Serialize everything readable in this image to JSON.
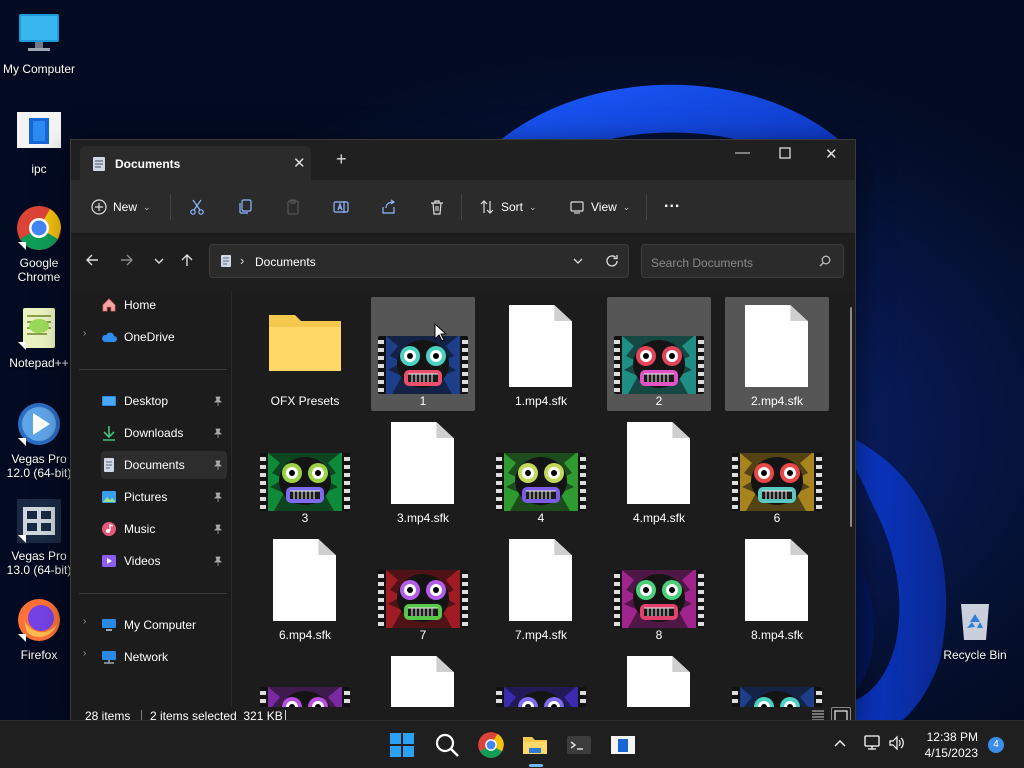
{
  "desktop": {
    "icons": [
      {
        "label": "My Computer"
      },
      {
        "label": "ipc"
      },
      {
        "label": "Google Chrome"
      },
      {
        "label": "Notepad++"
      },
      {
        "label": "Vegas Pro 12.0 (64-bit)"
      },
      {
        "label": "Vegas Pro 13.0 (64-bit)"
      },
      {
        "label": "Firefox"
      },
      {
        "label": "Recycle Bin"
      }
    ]
  },
  "explorer": {
    "tab_title": "Documents",
    "toolbar": {
      "new_label": "New",
      "sort_label": "Sort",
      "view_label": "View",
      "more_label": "..."
    },
    "address": {
      "path": "Documents"
    },
    "search": {
      "placeholder": "Search Documents"
    },
    "nav": {
      "home": "Home",
      "onedrive": "OneDrive",
      "quick": [
        "Desktop",
        "Downloads",
        "Documents",
        "Pictures",
        "Music",
        "Videos"
      ],
      "my_computer": "My Computer",
      "network": "Network"
    },
    "files": [
      {
        "name": "OFX Presets",
        "type": "folder",
        "selected": false
      },
      {
        "name": "1",
        "type": "video",
        "selected": true,
        "bg": "#1d3f8a",
        "eyes": "#4bd1c4",
        "mouth": "#e9506b"
      },
      {
        "name": "1.mp4.sfk",
        "type": "file",
        "selected": false
      },
      {
        "name": "2",
        "type": "video",
        "selected": true,
        "bg": "#1f8f86",
        "eyes": "#e2455a",
        "mouth": "#e254c6"
      },
      {
        "name": "2.mp4.sfk",
        "type": "file",
        "selected": true
      },
      {
        "name": "3",
        "type": "video",
        "selected": false,
        "bg": "#0f8a3a",
        "eyes": "#9bd245",
        "mouth": "#7d6cf2"
      },
      {
        "name": "3.mp4.sfk",
        "type": "file",
        "selected": false
      },
      {
        "name": "4",
        "type": "video",
        "selected": false,
        "bg": "#2f9a2f",
        "eyes": "#c4d85a",
        "mouth": "#7a5ce8"
      },
      {
        "name": "4.mp4.sfk",
        "type": "file",
        "selected": false
      },
      {
        "name": "6",
        "type": "video",
        "selected": false,
        "bg": "#a8841e",
        "eyes": "#e84848",
        "mouth": "#59c8c0"
      },
      {
        "name": "6.mp4.sfk",
        "type": "file",
        "selected": false
      },
      {
        "name": "7",
        "type": "video",
        "selected": false,
        "bg": "#a01c24",
        "eyes": "#b25ee8",
        "mouth": "#58c84a"
      },
      {
        "name": "7.mp4.sfk",
        "type": "file",
        "selected": false
      },
      {
        "name": "8",
        "type": "video",
        "selected": false,
        "bg": "#a0248c",
        "eyes": "#4ad07a",
        "mouth": "#e1416a"
      },
      {
        "name": "8.mp4.sfk",
        "type": "file",
        "selected": false
      },
      {
        "name": "",
        "type": "video",
        "selected": false,
        "bg": "#7a2aa0",
        "eyes": "#b84fe0",
        "mouth": "#e254c6"
      },
      {
        "name": "",
        "type": "file",
        "selected": false
      },
      {
        "name": "",
        "type": "video",
        "selected": false,
        "bg": "#3a2ab0",
        "eyes": "#7b6cf2",
        "mouth": "#e9506b"
      },
      {
        "name": "",
        "type": "file",
        "selected": false
      },
      {
        "name": "",
        "type": "video",
        "selected": false,
        "bg": "#1d3f8a",
        "eyes": "#4bd1c4",
        "mouth": "#e9506b"
      }
    ],
    "status": {
      "count": "28 items",
      "selection": "2 items selected  321 KB"
    }
  },
  "taskbar": {
    "time": "12:38 PM",
    "date": "4/15/2023",
    "notification_count": "4"
  },
  "colors": {
    "accent": "#0a84ff",
    "folder": "#f4c94e"
  }
}
